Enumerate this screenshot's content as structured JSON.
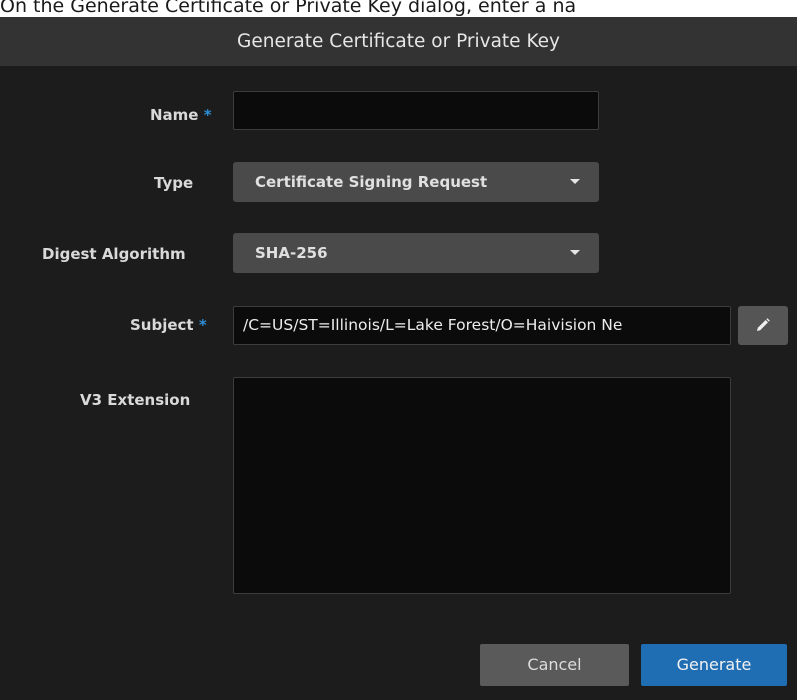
{
  "caption": "On the Generate Certificate or Private Key dialog, enter a na",
  "dialog": {
    "title": "Generate Certificate or Private Key"
  },
  "form": {
    "required_marker": "*",
    "name": {
      "label": "Name",
      "value": ""
    },
    "type": {
      "label": "Type",
      "selected": "Certificate Signing Request"
    },
    "digest_algorithm": {
      "label": "Digest Algorithm",
      "selected": "SHA-256"
    },
    "subject": {
      "label": "Subject",
      "value": "/C=US/ST=Illinois/L=Lake Forest/O=Haivision Ne"
    },
    "v3_extension": {
      "label": "V3 Extension",
      "value": ""
    }
  },
  "buttons": {
    "cancel": "Cancel",
    "generate": "Generate"
  },
  "icons": {
    "edit": "pencil-icon",
    "dropdown": "caret-down-icon"
  },
  "colors": {
    "accent": "#1f6eb4",
    "required": "#2e8ed8",
    "background": "#1c1c1c",
    "header": "#333333"
  }
}
